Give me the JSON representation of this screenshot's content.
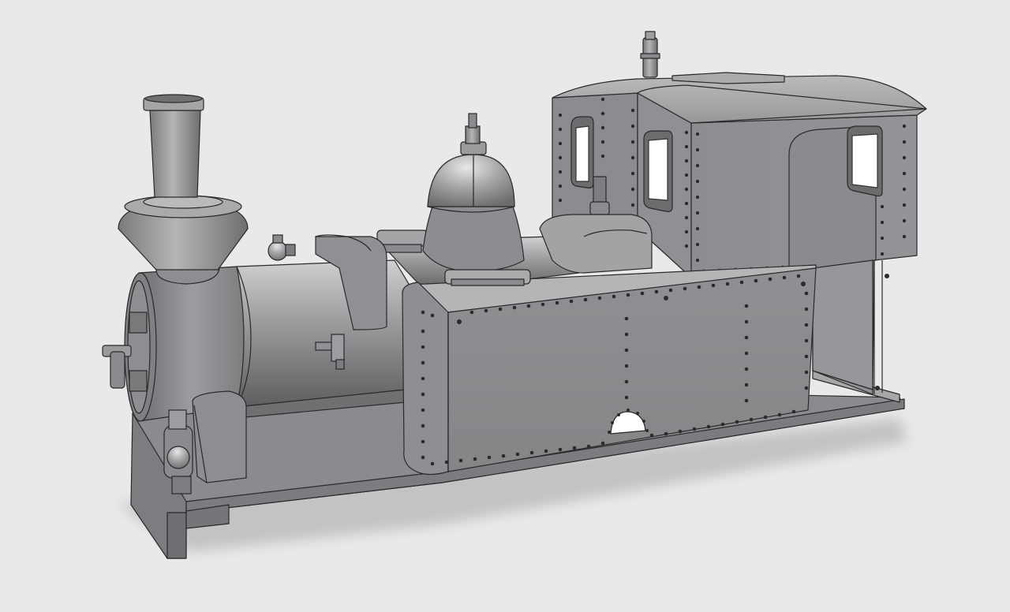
{
  "scene": {
    "subject": "locomotive-3d-model",
    "background_color": "#e9e9ea",
    "model_color": "#8f9093",
    "edge_color": "#2a2a2a"
  }
}
